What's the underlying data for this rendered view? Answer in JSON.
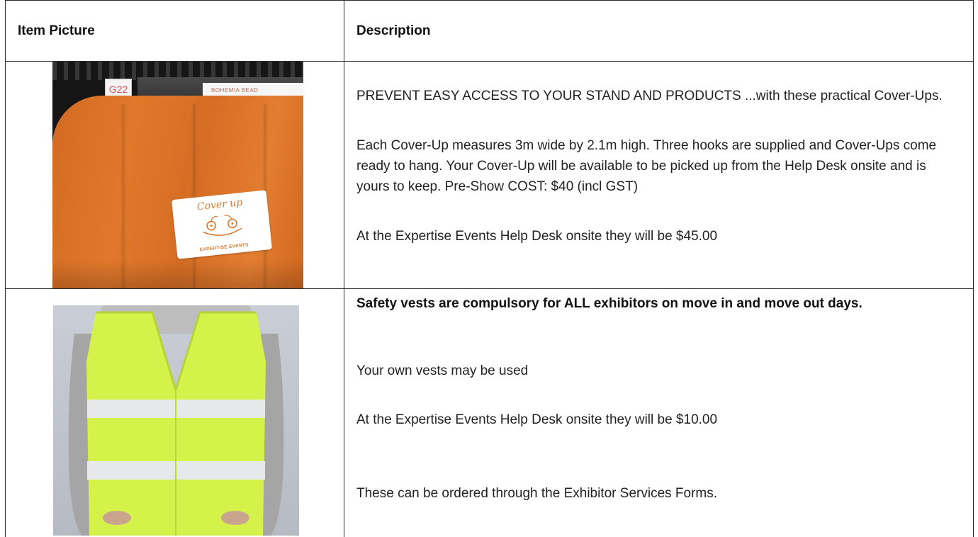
{
  "table": {
    "headers": {
      "item_picture": "Item Picture",
      "description": "Description"
    },
    "rows": [
      {
        "photo": {
          "sign_left": "G22",
          "sign_right": "BOHEMIA BEAD",
          "card_script": "Cover up",
          "card_brand": "EXPERTISE EVENTS",
          "drape_color": "#de772a"
        },
        "paragraphs": [
          "PREVENT EASY ACCESS TO YOUR STAND AND PRODUCTS ...with these practical Cover-Ups.",
          "Each Cover-Up measures 3m wide by 2.1m high. Three hooks are supplied and Cover-Ups come ready to hang. Your Cover-Up will be available to be picked up from the Help Desk onsite and is yours to keep. Pre-Show COST: $40 (incl GST)",
          "At the Expertise Events Help Desk onsite they will be $45.00"
        ]
      },
      {
        "photo": {
          "vest_color": "#d4f24a",
          "stripe_color": "#e6e8ea"
        },
        "paragraphs": [
          "Safety vests are compulsory for ALL exhibitors on move in and move out days.",
          "Your own vests may be used",
          "At the Expertise Events Help Desk onsite they will be $10.00",
          "These can be ordered through the Exhibitor Services Forms."
        ]
      }
    ]
  }
}
